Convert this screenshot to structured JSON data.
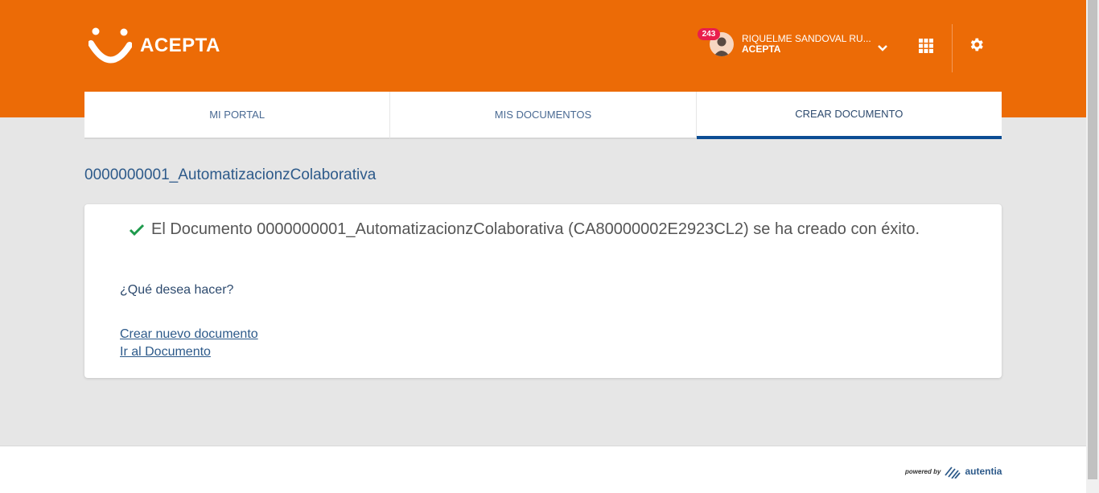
{
  "header": {
    "logo_text": "ACEPTA",
    "notification_count": "243",
    "user_name": "RIQUELME SANDOVAL RU...",
    "user_org": "ACEPTA"
  },
  "tabs": [
    {
      "label": "MI PORTAL",
      "active": false
    },
    {
      "label": "MIS DOCUMENTOS",
      "active": false
    },
    {
      "label": "CREAR DOCUMENTO",
      "active": true
    }
  ],
  "page": {
    "title": "0000000001_AutomatizacionzColaborativa",
    "success_message": "El Documento 0000000001_AutomatizacionzColaborativa (CA80000002E2923CL2) se ha creado con éxito.",
    "question": "¿Qué desea hacer?",
    "links": {
      "new_document": "Crear nuevo documento",
      "go_to_document": "Ir al Documento"
    }
  },
  "footer": {
    "powered_by": "powered by",
    "brand": "autentia"
  },
  "colors": {
    "brand_orange": "#ec6b06",
    "active_tab": "#0c4d94",
    "success_check": "#1e9a4c",
    "badge": "#e91e4c"
  },
  "icons": [
    "acepta-logo-icon",
    "avatar-icon",
    "chevron-down-icon",
    "apps-grid-icon",
    "gear-icon",
    "check-icon",
    "autentia-logo-icon"
  ]
}
